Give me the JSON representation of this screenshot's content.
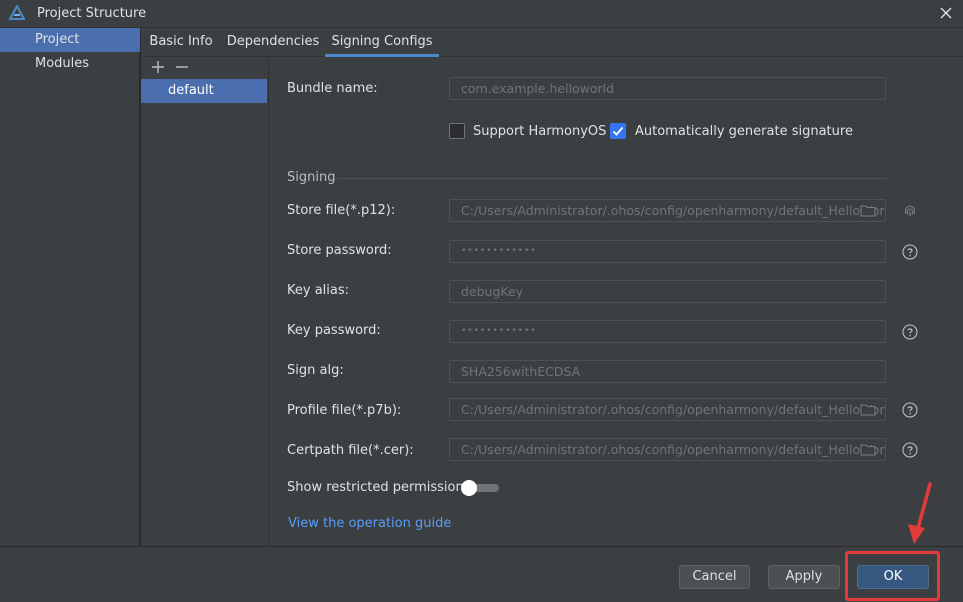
{
  "window": {
    "title": "Project Structure"
  },
  "colors": {
    "accent": "#4b6eaf",
    "link": "#589df6",
    "primary_button": "#365880",
    "annotation": "#e33a3a"
  },
  "left_nav": {
    "items": [
      {
        "label": "Project",
        "selected": true
      },
      {
        "label": "Modules",
        "selected": false
      }
    ]
  },
  "tabs": [
    {
      "label": "Basic Info",
      "active": false
    },
    {
      "label": "Dependencies",
      "active": false
    },
    {
      "label": "Signing Configs",
      "active": true
    }
  ],
  "config_list": {
    "add_icon": "plus-icon",
    "remove_icon": "minus-icon",
    "items": [
      "default"
    ]
  },
  "form": {
    "bundle_name": {
      "label": "Bundle name:",
      "value": "com.example.helloworld"
    },
    "support_harmonyos": {
      "label": "Support HarmonyOS",
      "checked": false
    },
    "auto_signature": {
      "label": "Automatically generate signature",
      "checked": true
    },
    "signing_section": "Signing",
    "store_file": {
      "label": "Store file(*.p12):",
      "value": "C:/Users/Administrator/.ohos/config/openharmony/default_HelloWorld"
    },
    "store_password": {
      "label": "Store password:",
      "value": "••••••••••••"
    },
    "key_alias": {
      "label": "Key alias:",
      "value": "debugKey"
    },
    "key_password": {
      "label": "Key password:",
      "value": "••••••••••••"
    },
    "sign_alg": {
      "label": "Sign alg:",
      "value": "SHA256withECDSA"
    },
    "profile_file": {
      "label": "Profile file(*.p7b):",
      "value": "C:/Users/Administrator/.ohos/config/openharmony/default_HelloWorld"
    },
    "certpath_file": {
      "label": "Certpath file(*.cer):",
      "value": "C:/Users/Administrator/.ohos/config/openharmony/default_HelloWorld"
    },
    "show_restricted": {
      "label": "Show restricted permissions",
      "on": false
    },
    "guide_link": "View the operation guide"
  },
  "footer": {
    "cancel": "Cancel",
    "apply": "Apply",
    "ok": "OK"
  }
}
